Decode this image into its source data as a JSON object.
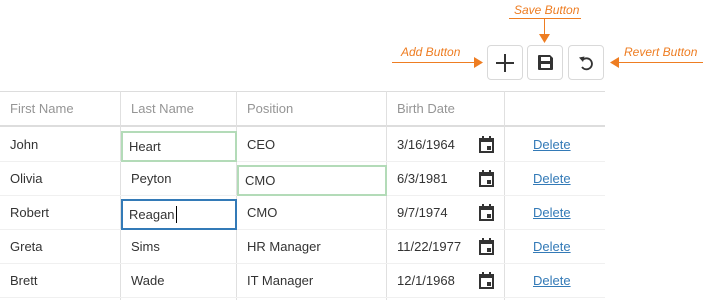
{
  "annotations": {
    "save": "Save Button",
    "add": "Add Button",
    "revert": "Revert Button"
  },
  "toolbar": {
    "add_icon": "plus-icon",
    "save_icon": "floppy-disk-icon",
    "revert_icon": "undo-arrow-icon"
  },
  "columns": [
    "First Name",
    "Last Name",
    "Position",
    "Birth Date"
  ],
  "rows": [
    {
      "first": "John",
      "last": "Heart",
      "position": "CEO",
      "birth": "3/16/1964",
      "action": "Delete"
    },
    {
      "first": "Olivia",
      "last": "Peyton",
      "position": "CMO",
      "birth": "6/3/1981",
      "action": "Delete"
    },
    {
      "first": "Robert",
      "last": "Reagan",
      "position": "CMO",
      "birth": "9/7/1974",
      "action": "Delete"
    },
    {
      "first": "Greta",
      "last": "Sims",
      "position": "HR Manager",
      "birth": "11/22/1977",
      "action": "Delete"
    },
    {
      "first": "Brett",
      "last": "Wade",
      "position": "IT Manager",
      "birth": "12/1/1968",
      "action": "Delete"
    }
  ],
  "colors": {
    "accent": "#ee7d22",
    "link": "#337ab7",
    "modified_cell": "#b3dbb8",
    "focused_cell": "#337ab7"
  }
}
